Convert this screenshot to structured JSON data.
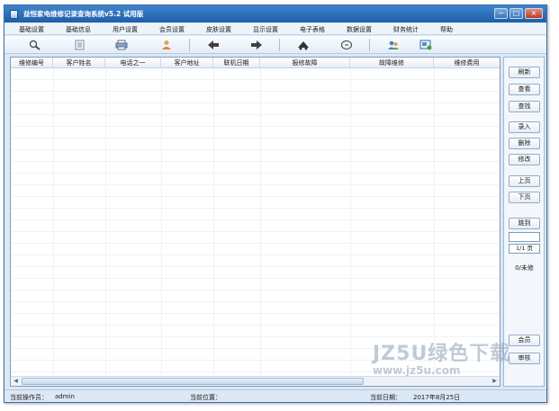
{
  "window": {
    "title": "益恒家电维修记录查询系统v5.2 试用版",
    "controls": {
      "minimize": "−",
      "maximize": "□",
      "close": "×"
    }
  },
  "menu": [
    "基础设置",
    "基础信息",
    "用户设置",
    "会员设置",
    "皮肤设置",
    "显示设置",
    "电子表格",
    "数据设置",
    "财务统计",
    "帮助"
  ],
  "toolbar": {
    "icons": [
      "search-tool-icon",
      "report-tool-icon",
      "print-tool-icon",
      "user-tool-icon",
      "back-arrow-icon",
      "forward-arrow-icon",
      "scissors-tool-icon",
      "gear-tool-icon",
      "users-tool-icon",
      "export-tool-icon"
    ]
  },
  "table": {
    "columns": [
      "维修编号",
      "客户姓名",
      "电话之一",
      "客户地址",
      "联机日期",
      "报修故障",
      "故障维修",
      "维修费用"
    ],
    "rows": []
  },
  "sidebar": {
    "refresh": "刷新",
    "view": "查看",
    "search": "查找",
    "add": "录入",
    "delete": "删除",
    "edit": "修改",
    "prev_page": "上页",
    "next_page": "下页",
    "jump": "跳到",
    "page_input": "",
    "page_indicator": "1/1 页",
    "pending": "0/未修",
    "member": "会员",
    "audit": "审核"
  },
  "status": {
    "operator_label": "当前操作员：",
    "operator": "admin",
    "location_label": "当前位置：",
    "location": "",
    "date_label": "当前日期：",
    "date": "2017年8月25日"
  },
  "watermark": {
    "line1": "JZ5U绿色下载",
    "line2": "www.jz5u.com"
  },
  "colors": {
    "titlebar": "#1f5ea8",
    "frame": "#dce8f5",
    "grid_border": "#7f9db9"
  }
}
